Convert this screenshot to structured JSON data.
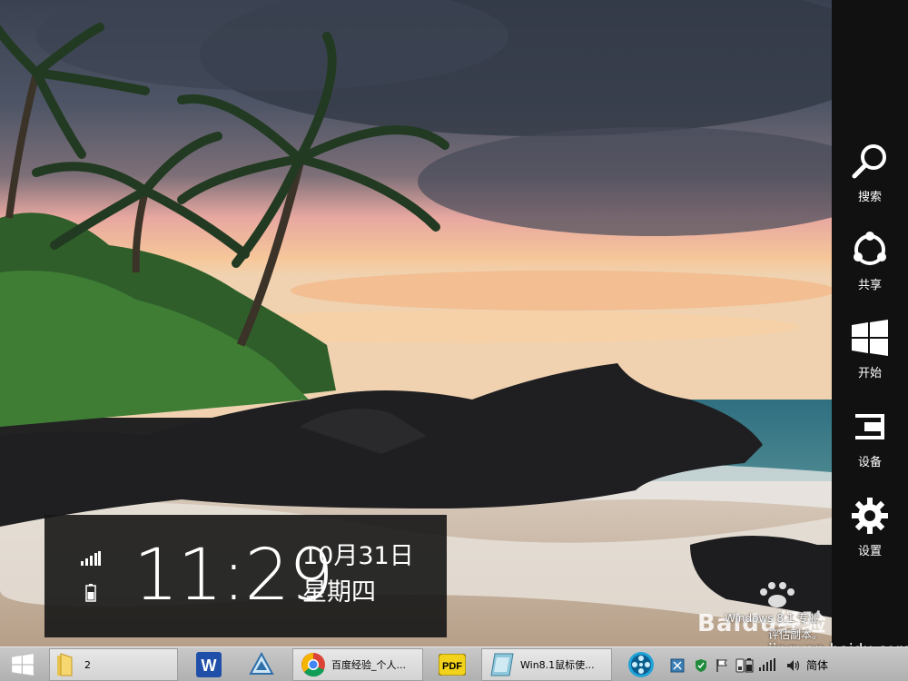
{
  "charms": {
    "search_label": "搜索",
    "share_label": "共享",
    "start_label": "开始",
    "devices_label": "设备",
    "settings_label": "设置"
  },
  "clock": {
    "time": "11:29",
    "date": "10月31日",
    "weekday": "星期四"
  },
  "watermark": {
    "version": "Windows 8.1 专业",
    "build": "评估副本。",
    "logo_text": "Baidu经验",
    "url": "jingyan.baidu.com"
  },
  "taskbar": {
    "items": [
      {
        "name": "start-button",
        "icon": "windows-logo-icon",
        "label": ""
      },
      {
        "name": "file-explorer",
        "icon": "folder-icon",
        "label": "2"
      },
      {
        "name": "wps-writer",
        "icon": "wps-w-icon",
        "label": ""
      },
      {
        "name": "remote-app",
        "icon": "triangle-app-icon",
        "label": ""
      },
      {
        "name": "chrome",
        "icon": "chrome-icon",
        "label": "百度经验_个人..."
      },
      {
        "name": "pdf-app",
        "icon": "pdf-icon",
        "label": ""
      },
      {
        "name": "win81-doc",
        "icon": "document-icon",
        "label": "Win8.1鼠标使..."
      },
      {
        "name": "media-app",
        "icon": "film-reel-icon",
        "label": ""
      }
    ],
    "tray": {
      "ime": "简体"
    }
  },
  "colors": {
    "charms_bg": "#111111",
    "taskbar_bg": "#bdbdbd",
    "clock_bg": "#161616"
  }
}
